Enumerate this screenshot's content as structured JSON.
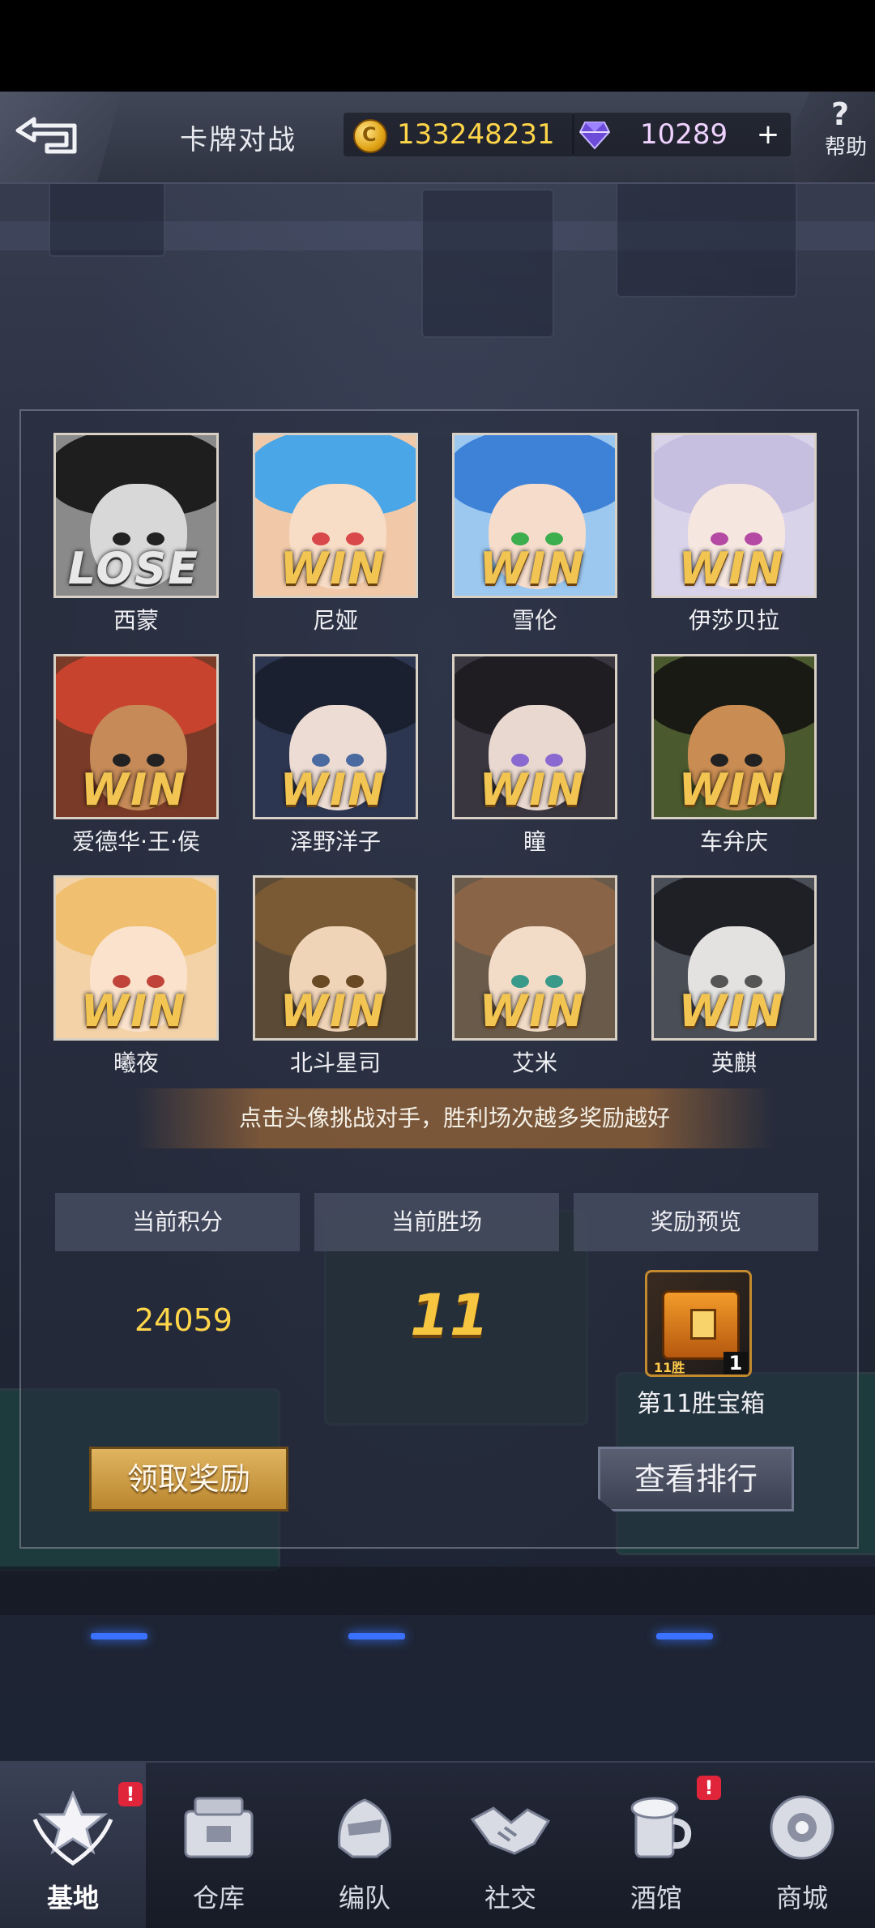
{
  "header": {
    "title": "卡牌对战",
    "coins": "133248231",
    "gems": "10289",
    "plus": "+",
    "help_label": "帮助",
    "help_q": "?"
  },
  "opponents": [
    {
      "name": "西蒙",
      "result": "LOSE"
    },
    {
      "name": "尼娅",
      "result": "WIN"
    },
    {
      "name": "雪伦",
      "result": "WIN"
    },
    {
      "name": "伊莎贝拉",
      "result": "WIN"
    },
    {
      "name": "爱德华·王·侯",
      "result": "WIN"
    },
    {
      "name": "泽野洋子",
      "result": "WIN"
    },
    {
      "name": "瞳",
      "result": "WIN"
    },
    {
      "name": "车弁庆",
      "result": "WIN"
    },
    {
      "name": "曦夜",
      "result": "WIN"
    },
    {
      "name": "北斗星司",
      "result": "WIN"
    },
    {
      "name": "艾米",
      "result": "WIN"
    },
    {
      "name": "英麒",
      "result": "WIN"
    }
  ],
  "hint": "点击头像挑战对手，胜利场次越多奖励越好",
  "stats": {
    "score_label": "当前积分",
    "wins_label": "当前胜场",
    "reward_label": "奖励预览",
    "score_value": "24059",
    "wins_value": "11",
    "chest_label": "第11胜宝箱",
    "chest_tag": "11胜",
    "chest_qty": "1"
  },
  "buttons": {
    "claim": "领取奖励",
    "rank": "查看排行"
  },
  "nav": [
    {
      "label": "基地",
      "icon": "base-icon",
      "badge": "!"
    },
    {
      "label": "仓库",
      "icon": "warehouse-icon"
    },
    {
      "label": "编队",
      "icon": "formation-icon"
    },
    {
      "label": "社交",
      "icon": "social-icon"
    },
    {
      "label": "酒馆",
      "icon": "tavern-icon",
      "badge": "!"
    },
    {
      "label": "商城",
      "icon": "shop-icon"
    }
  ],
  "colors": {
    "accent_gold": "#f2c451",
    "coin_text": "#ffd54a",
    "gem_text": "#f0d2ff",
    "badge_red": "#e0243a"
  }
}
